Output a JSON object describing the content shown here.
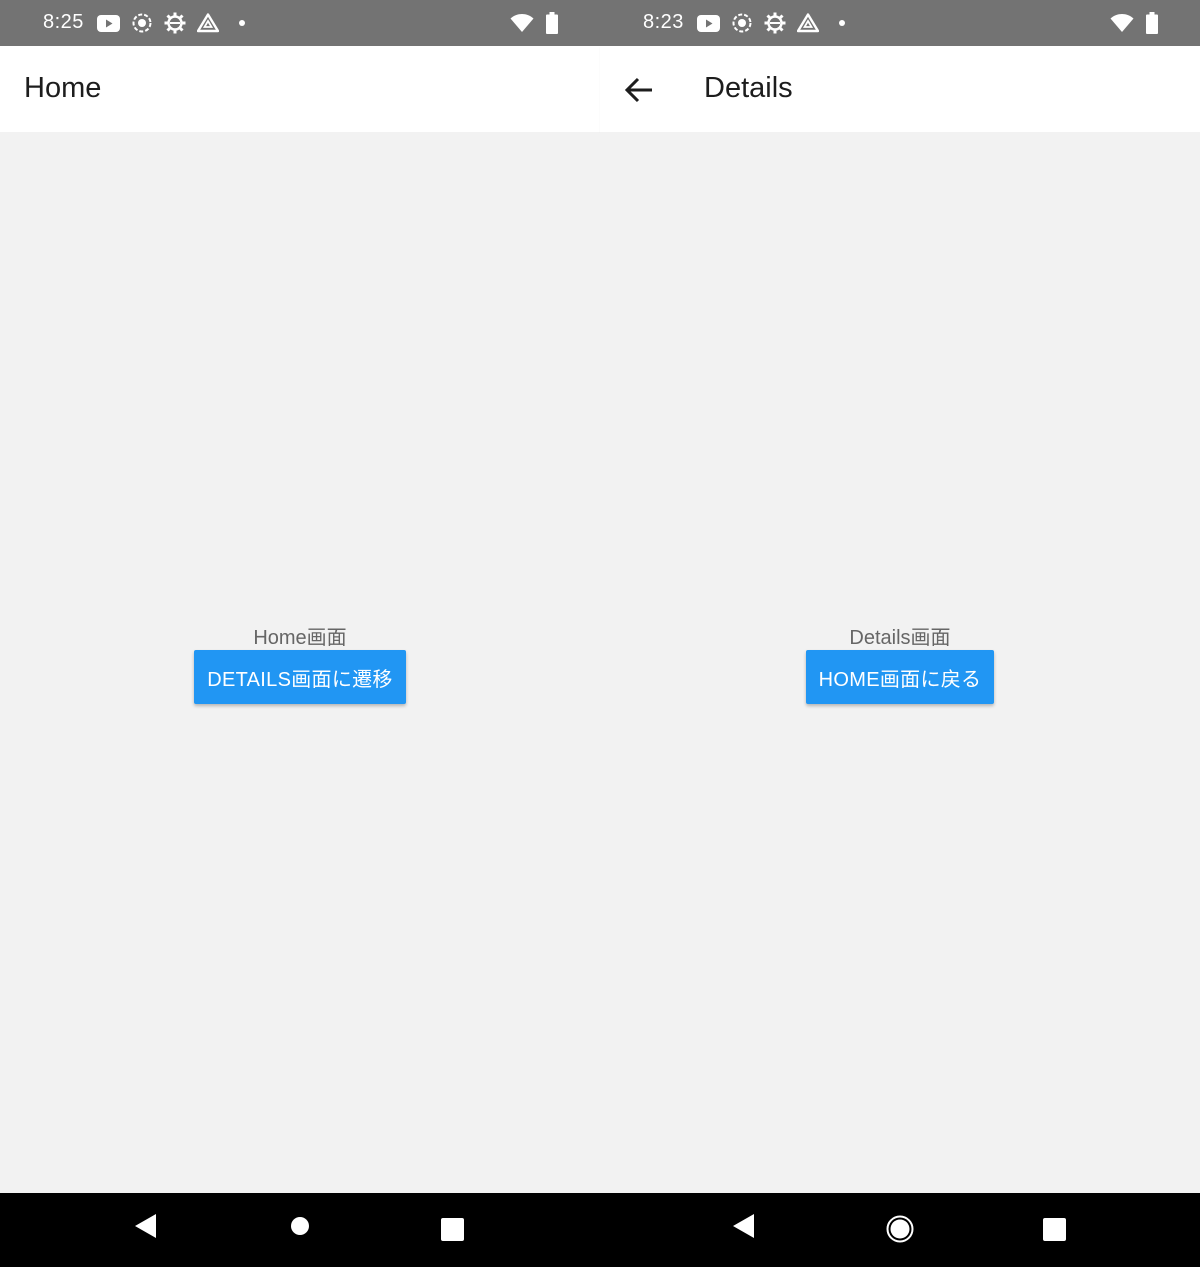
{
  "left_screen": {
    "status_bar": {
      "time": "8:25",
      "icons": [
        "youtube-icon",
        "record-icon",
        "settings-gear-icon",
        "drive-icon",
        "dot-icon"
      ],
      "right_icons": [
        "wifi-icon",
        "battery-icon"
      ]
    },
    "app_bar": {
      "title": "Home"
    },
    "content": {
      "label": "Home画面",
      "button_label": "DETAILS画面に遷移"
    }
  },
  "right_screen": {
    "status_bar": {
      "time": "8:23",
      "icons": [
        "youtube-icon",
        "record-icon",
        "settings-gear-icon",
        "drive-icon",
        "dot-icon"
      ],
      "right_icons": [
        "wifi-icon",
        "battery-icon"
      ]
    },
    "app_bar": {
      "title": "Details",
      "back_icon": "arrow-back-icon"
    },
    "content": {
      "label": "Details画面",
      "button_label": "HOME画面に戻る"
    }
  },
  "navigation_bar": {
    "buttons": [
      "back-icon",
      "home-icon",
      "recents-icon"
    ]
  },
  "colors": {
    "status_bar": "#737373",
    "app_bar": "#ffffff",
    "background": "#f2f2f2",
    "button": "#2196f3",
    "nav_bar": "#000000"
  }
}
